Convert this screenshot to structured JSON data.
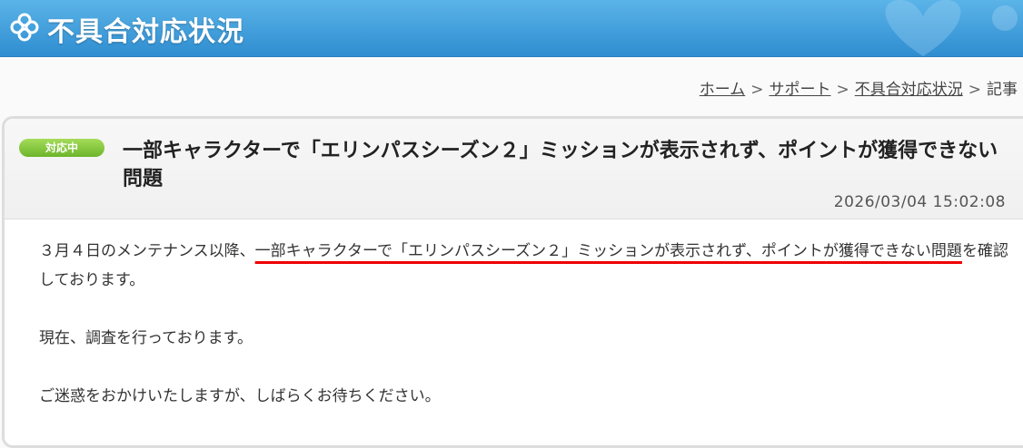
{
  "header": {
    "title": "不具合対応状況",
    "logo_icon": "clover-icon",
    "colors": {
      "bar_top": "#5bb4e8",
      "bar_bottom": "#2f8dd0"
    }
  },
  "breadcrumb": {
    "items": [
      "ホーム",
      "サポート",
      "不具合対応状況"
    ],
    "current": "記事",
    "separator": ">"
  },
  "article": {
    "status": "対応中",
    "title": "一部キャラクターで「エリンパスシーズン２」ミッションが表示されず、ポイントが獲得できない問題",
    "date": "2026/03/04 15:02:08",
    "body": {
      "p1_before": "３月４日のメンテナンス以降、",
      "p1_highlight": "一部キャラクターで「エリンパスシーズン２」ミッションが表示されず、ポイントが獲得できない問題",
      "p1_after": "を確認しております。",
      "p2": "現在、調査を行っております。",
      "p3": "ご迷惑をおかけいたしますが、しばらくお待ちください。"
    }
  }
}
